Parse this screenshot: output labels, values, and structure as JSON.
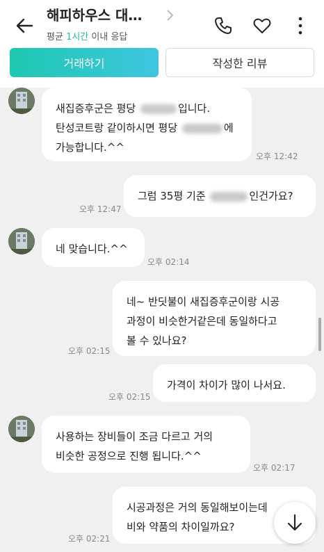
{
  "header": {
    "title": "해피하우스 대…",
    "subtitle_prefix": "평균",
    "subtitle_highlight": "1시간",
    "subtitle_suffix": "이내 응답",
    "accent_color": "#20b9a8"
  },
  "actions": {
    "trade_label": "거래하기",
    "review_label": "작성한 리뷰"
  },
  "messages": [
    {
      "side": "received",
      "parts": [
        "새집증후군은 평당 ",
        "[blurred]",
        "입니다.\n탄성코트랑 같이하시면 평당 ",
        "[blurred]",
        "에\n가능합니다.^^"
      ],
      "time": "오후 12:42"
    },
    {
      "side": "sent",
      "parts": [
        "그럼 35평 기준 ",
        "[blurred]",
        "인건가요?"
      ],
      "time": "오후 12:47"
    },
    {
      "side": "received",
      "text": "네 맞습니다.^^",
      "time": "오후 02:14"
    },
    {
      "side": "sent",
      "text": "네~ 반딧불이 새집증후군이랑 시공\n과정이 비슷한거같은데 동일하다고\n볼 수 있나요?",
      "time": "오후 02:15"
    },
    {
      "side": "sent",
      "text": "가격이 차이가 많이 나서요.",
      "time": "오후 02:15"
    },
    {
      "side": "received",
      "text": "사용하는 장비들이 조금 다르고 거의\n비슷한 공정으로 진행 됩니다.^^",
      "time": "오후 02:17"
    },
    {
      "side": "sent",
      "text": "시공과정은 거의 동일해보이는데\n비와 약품의 차이일까요?",
      "time": "오후 02:21"
    }
  ]
}
